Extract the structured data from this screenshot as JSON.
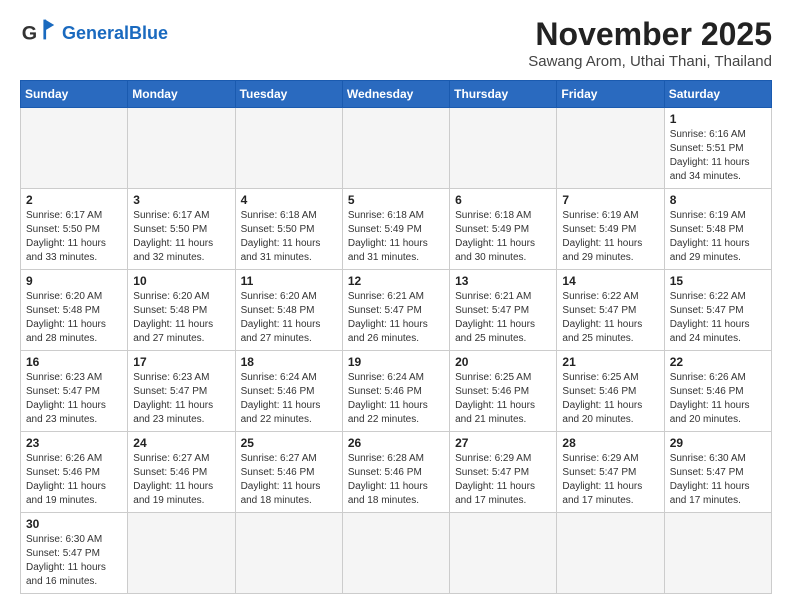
{
  "header": {
    "logo_general": "General",
    "logo_blue": "Blue",
    "month_title": "November 2025",
    "location": "Sawang Arom, Uthai Thani, Thailand"
  },
  "days_of_week": [
    "Sunday",
    "Monday",
    "Tuesday",
    "Wednesday",
    "Thursday",
    "Friday",
    "Saturday"
  ],
  "weeks": [
    [
      {
        "day": "",
        "info": ""
      },
      {
        "day": "",
        "info": ""
      },
      {
        "day": "",
        "info": ""
      },
      {
        "day": "",
        "info": ""
      },
      {
        "day": "",
        "info": ""
      },
      {
        "day": "",
        "info": ""
      },
      {
        "day": "1",
        "info": "Sunrise: 6:16 AM\nSunset: 5:51 PM\nDaylight: 11 hours\nand 34 minutes."
      }
    ],
    [
      {
        "day": "2",
        "info": "Sunrise: 6:17 AM\nSunset: 5:50 PM\nDaylight: 11 hours\nand 33 minutes."
      },
      {
        "day": "3",
        "info": "Sunrise: 6:17 AM\nSunset: 5:50 PM\nDaylight: 11 hours\nand 32 minutes."
      },
      {
        "day": "4",
        "info": "Sunrise: 6:18 AM\nSunset: 5:50 PM\nDaylight: 11 hours\nand 31 minutes."
      },
      {
        "day": "5",
        "info": "Sunrise: 6:18 AM\nSunset: 5:49 PM\nDaylight: 11 hours\nand 31 minutes."
      },
      {
        "day": "6",
        "info": "Sunrise: 6:18 AM\nSunset: 5:49 PM\nDaylight: 11 hours\nand 30 minutes."
      },
      {
        "day": "7",
        "info": "Sunrise: 6:19 AM\nSunset: 5:49 PM\nDaylight: 11 hours\nand 29 minutes."
      },
      {
        "day": "8",
        "info": "Sunrise: 6:19 AM\nSunset: 5:48 PM\nDaylight: 11 hours\nand 29 minutes."
      }
    ],
    [
      {
        "day": "9",
        "info": "Sunrise: 6:20 AM\nSunset: 5:48 PM\nDaylight: 11 hours\nand 28 minutes."
      },
      {
        "day": "10",
        "info": "Sunrise: 6:20 AM\nSunset: 5:48 PM\nDaylight: 11 hours\nand 27 minutes."
      },
      {
        "day": "11",
        "info": "Sunrise: 6:20 AM\nSunset: 5:48 PM\nDaylight: 11 hours\nand 27 minutes."
      },
      {
        "day": "12",
        "info": "Sunrise: 6:21 AM\nSunset: 5:47 PM\nDaylight: 11 hours\nand 26 minutes."
      },
      {
        "day": "13",
        "info": "Sunrise: 6:21 AM\nSunset: 5:47 PM\nDaylight: 11 hours\nand 25 minutes."
      },
      {
        "day": "14",
        "info": "Sunrise: 6:22 AM\nSunset: 5:47 PM\nDaylight: 11 hours\nand 25 minutes."
      },
      {
        "day": "15",
        "info": "Sunrise: 6:22 AM\nSunset: 5:47 PM\nDaylight: 11 hours\nand 24 minutes."
      }
    ],
    [
      {
        "day": "16",
        "info": "Sunrise: 6:23 AM\nSunset: 5:47 PM\nDaylight: 11 hours\nand 23 minutes."
      },
      {
        "day": "17",
        "info": "Sunrise: 6:23 AM\nSunset: 5:47 PM\nDaylight: 11 hours\nand 23 minutes."
      },
      {
        "day": "18",
        "info": "Sunrise: 6:24 AM\nSunset: 5:46 PM\nDaylight: 11 hours\nand 22 minutes."
      },
      {
        "day": "19",
        "info": "Sunrise: 6:24 AM\nSunset: 5:46 PM\nDaylight: 11 hours\nand 22 minutes."
      },
      {
        "day": "20",
        "info": "Sunrise: 6:25 AM\nSunset: 5:46 PM\nDaylight: 11 hours\nand 21 minutes."
      },
      {
        "day": "21",
        "info": "Sunrise: 6:25 AM\nSunset: 5:46 PM\nDaylight: 11 hours\nand 20 minutes."
      },
      {
        "day": "22",
        "info": "Sunrise: 6:26 AM\nSunset: 5:46 PM\nDaylight: 11 hours\nand 20 minutes."
      }
    ],
    [
      {
        "day": "23",
        "info": "Sunrise: 6:26 AM\nSunset: 5:46 PM\nDaylight: 11 hours\nand 19 minutes."
      },
      {
        "day": "24",
        "info": "Sunrise: 6:27 AM\nSunset: 5:46 PM\nDaylight: 11 hours\nand 19 minutes."
      },
      {
        "day": "25",
        "info": "Sunrise: 6:27 AM\nSunset: 5:46 PM\nDaylight: 11 hours\nand 18 minutes."
      },
      {
        "day": "26",
        "info": "Sunrise: 6:28 AM\nSunset: 5:46 PM\nDaylight: 11 hours\nand 18 minutes."
      },
      {
        "day": "27",
        "info": "Sunrise: 6:29 AM\nSunset: 5:47 PM\nDaylight: 11 hours\nand 17 minutes."
      },
      {
        "day": "28",
        "info": "Sunrise: 6:29 AM\nSunset: 5:47 PM\nDaylight: 11 hours\nand 17 minutes."
      },
      {
        "day": "29",
        "info": "Sunrise: 6:30 AM\nSunset: 5:47 PM\nDaylight: 11 hours\nand 17 minutes."
      }
    ],
    [
      {
        "day": "30",
        "info": "Sunrise: 6:30 AM\nSunset: 5:47 PM\nDaylight: 11 hours\nand 16 minutes."
      },
      {
        "day": "",
        "info": ""
      },
      {
        "day": "",
        "info": ""
      },
      {
        "day": "",
        "info": ""
      },
      {
        "day": "",
        "info": ""
      },
      {
        "day": "",
        "info": ""
      },
      {
        "day": "",
        "info": ""
      }
    ]
  ]
}
